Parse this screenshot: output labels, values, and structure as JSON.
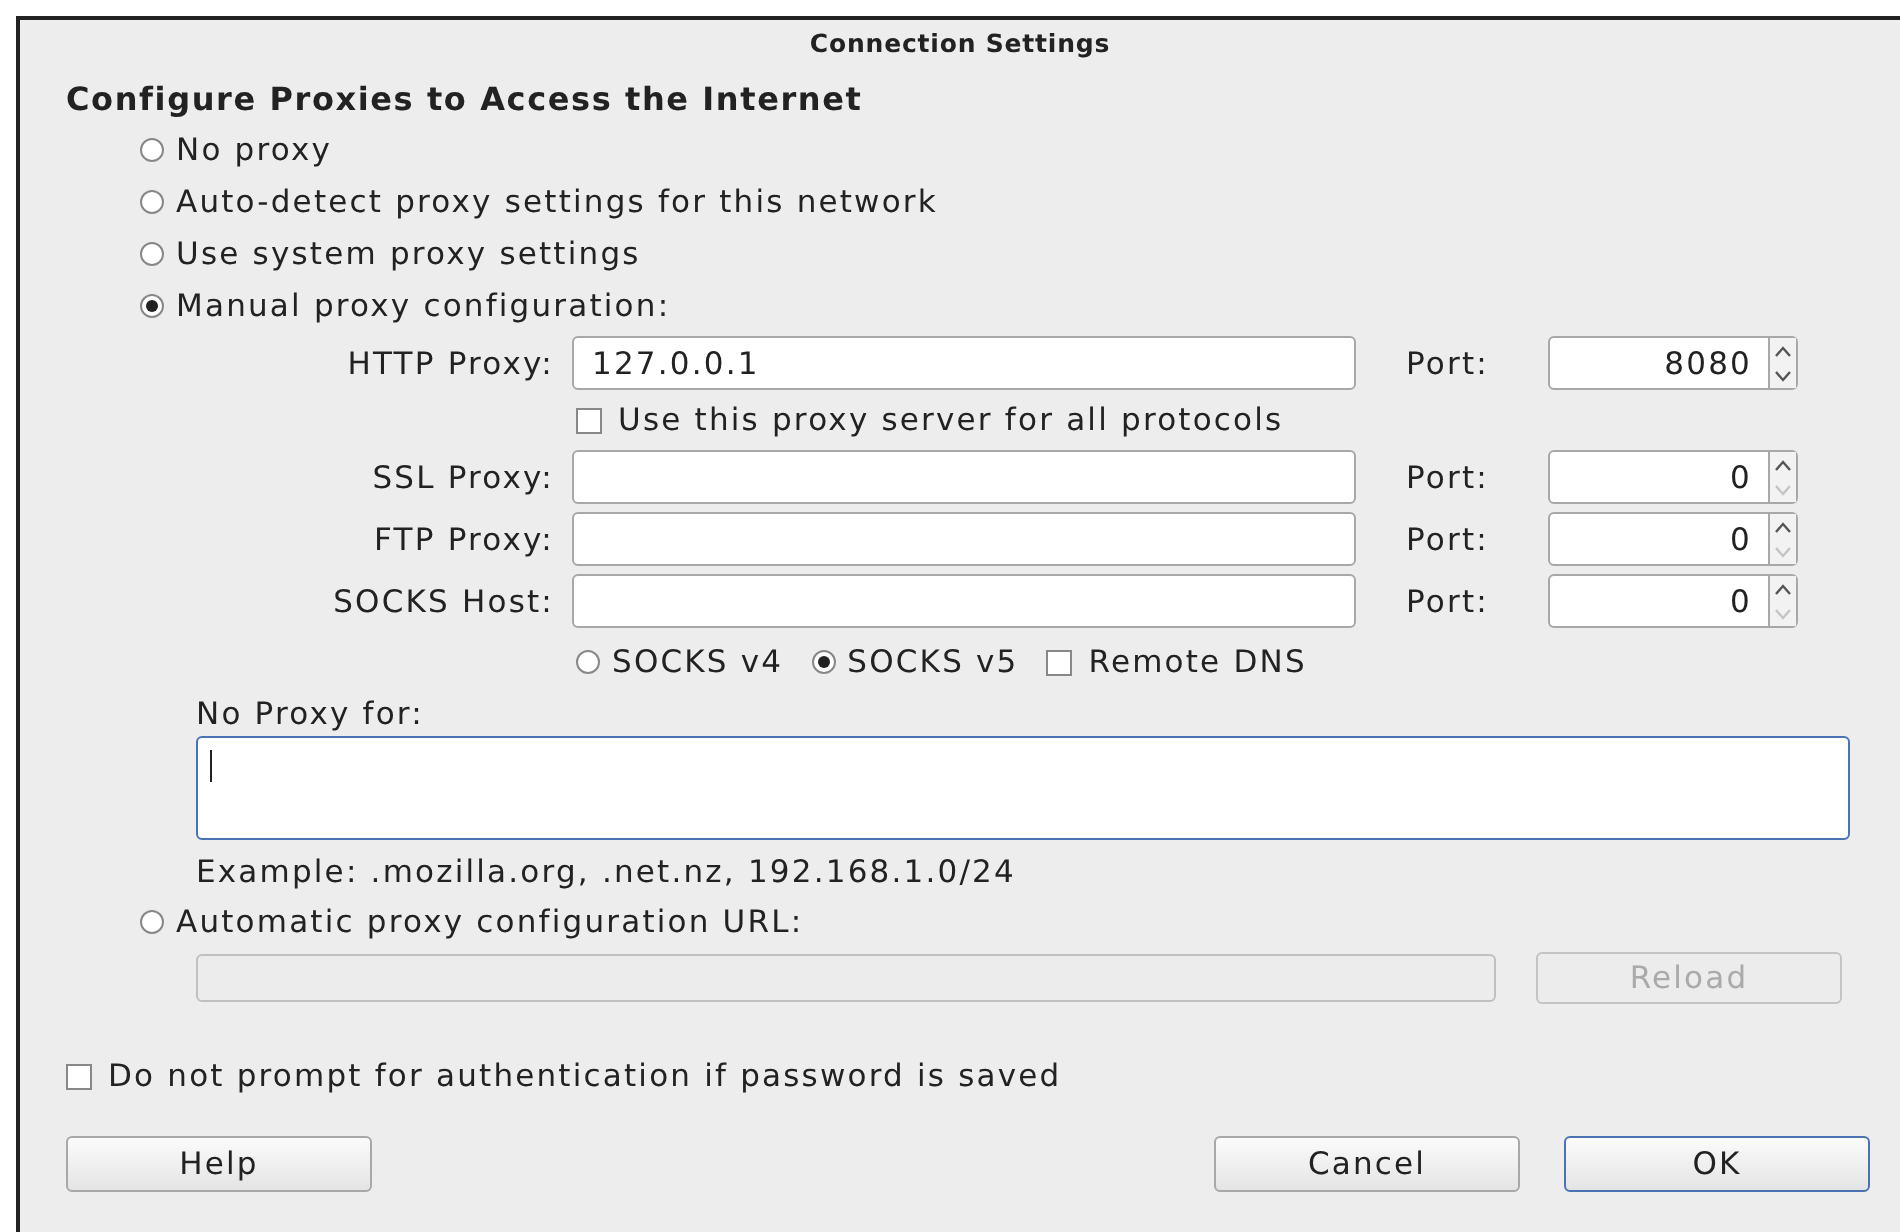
{
  "window": {
    "title": "Connection Settings"
  },
  "heading": "Configure Proxies to Access the Internet",
  "modes": [
    {
      "label": "No proxy",
      "selected": false
    },
    {
      "label": "Auto-detect proxy settings for this network",
      "selected": false
    },
    {
      "label": "Use system proxy settings",
      "selected": false
    },
    {
      "label": "Manual proxy configuration:",
      "selected": true
    }
  ],
  "manual_rows": [
    {
      "kind": "proxy",
      "label": "HTTP Proxy:",
      "value": "127.0.0.1",
      "port_label": "Port:",
      "port": "8080",
      "down_disabled": false
    },
    {
      "kind": "checkbox",
      "label": "Use this proxy server for all protocols",
      "checked": false
    },
    {
      "kind": "proxy",
      "label": "SSL Proxy:",
      "port_label": "Port:",
      "port": "0",
      "down_disabled": true
    },
    {
      "kind": "proxy",
      "label": "FTP Proxy:",
      "port_label": "Port:",
      "port": "0",
      "down_disabled": true
    },
    {
      "kind": "proxy",
      "label": "SOCKS Host:",
      "port_label": "Port:",
      "port": "0",
      "down_disabled": true
    }
  ],
  "socks_options": [
    {
      "kind": "radio",
      "label": "SOCKS v4",
      "selected": false
    },
    {
      "kind": "radio",
      "label": "SOCKS v5",
      "selected": true
    },
    {
      "kind": "checkbox",
      "label": "Remote DNS",
      "checked": false
    }
  ],
  "no_proxy": {
    "label": "No Proxy for:",
    "focused": true
  },
  "example": "Example: .mozilla.org, .net.nz, 192.168.1.0/24",
  "auto_config": {
    "label": "Automatic proxy configuration URL:",
    "selected": false,
    "field_disabled": true,
    "reload": {
      "label": "Reload",
      "disabled": true
    }
  },
  "auth_checkbox": {
    "label": "Do not prompt for authentication if password is saved",
    "checked": false
  },
  "left_buttons": [
    {
      "label": "Help",
      "default": false
    }
  ],
  "right_buttons": [
    {
      "label": "Cancel",
      "default": false
    },
    {
      "label": "OK",
      "default": true
    }
  ]
}
